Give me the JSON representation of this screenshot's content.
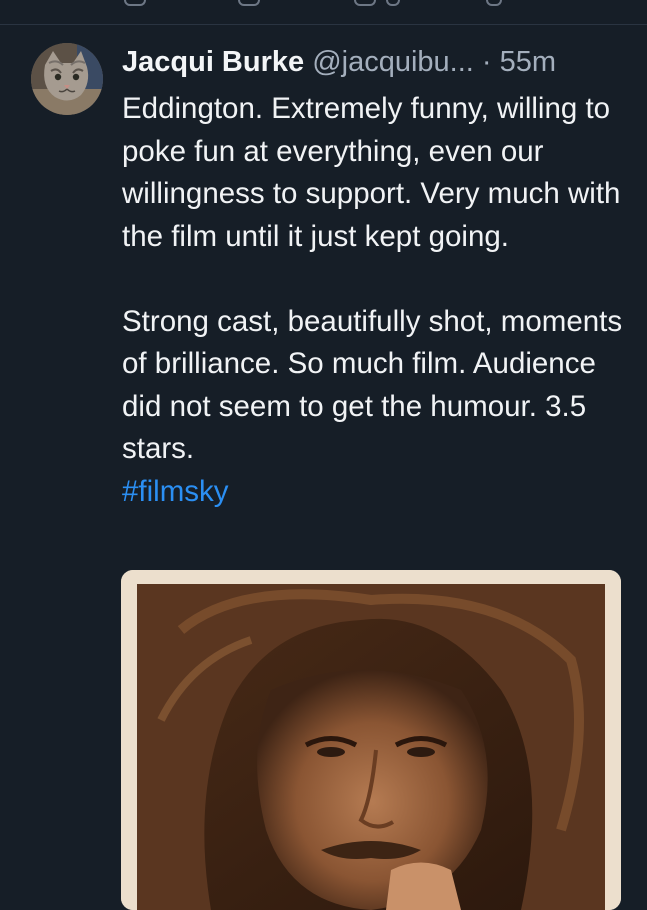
{
  "post": {
    "author_name": "Jacqui Burke",
    "author_handle": "@jacquibu...",
    "separator": "·",
    "time": "55m",
    "paragraph1": "Eddington. Extremely funny, willing to poke fun at everything, even our willingness to support. Very much with the film until it just kept going.",
    "paragraph2": "Strong cast, beautifully shot, moments of brilliance. So much film. Audience did not seem to get the humour. 3.5 stars.",
    "hashtag": "#filmsky"
  },
  "colors": {
    "background": "#161e27",
    "text": "#f1f3f5",
    "muted": "#a4afbd",
    "link": "#2b8ff3"
  },
  "icons": [
    "reply-icon",
    "repost-icon",
    "like-icon",
    "more-icon"
  ]
}
